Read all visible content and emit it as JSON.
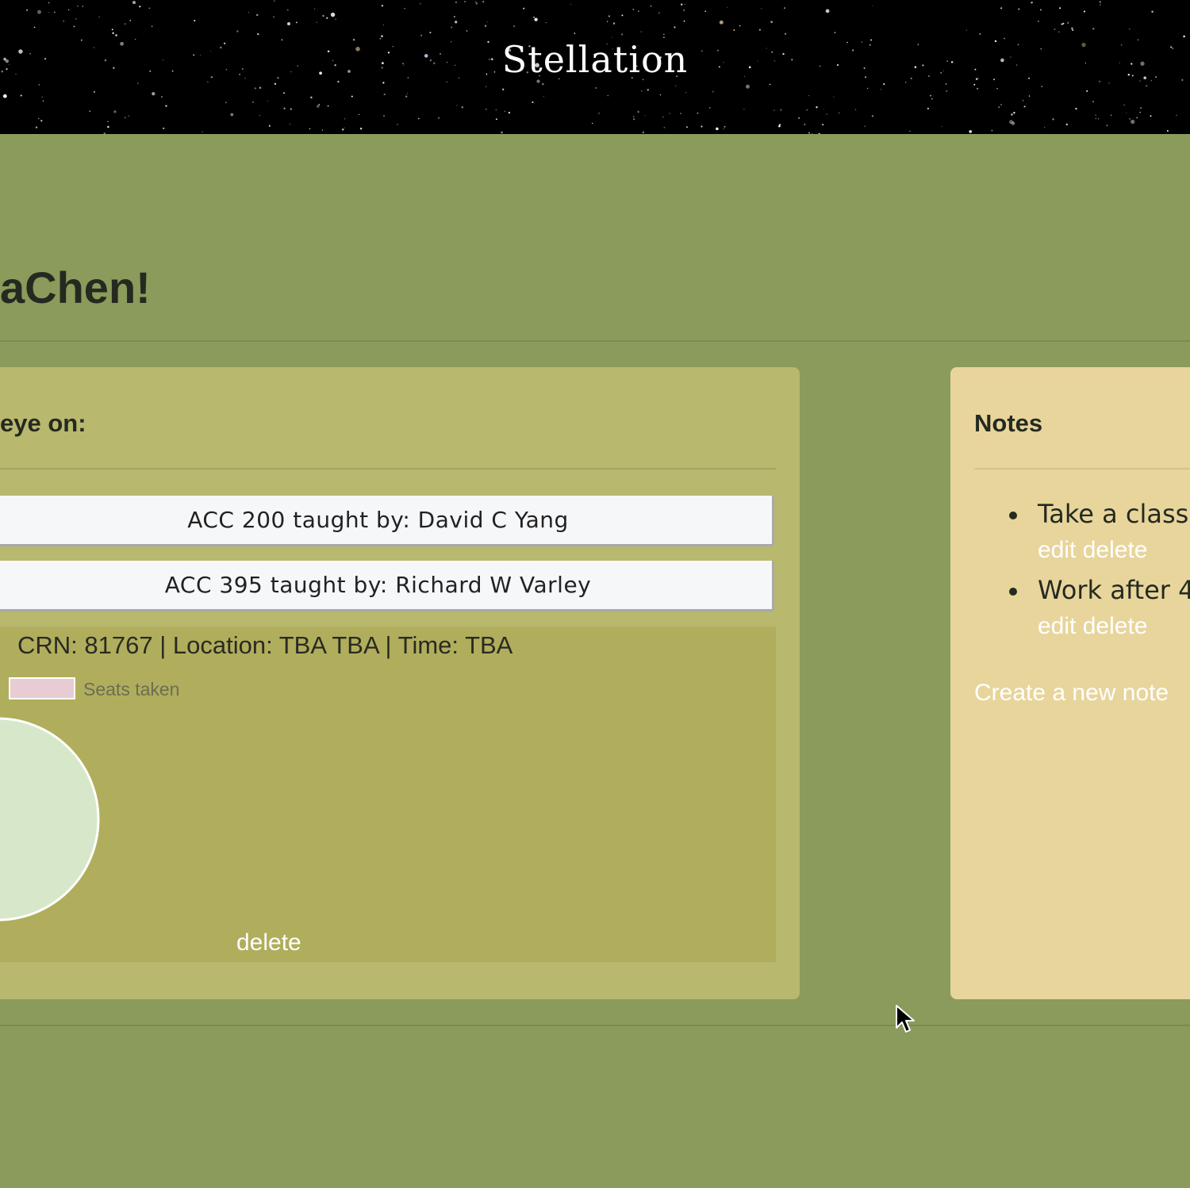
{
  "header": {
    "brand": "Stellation"
  },
  "welcome": {
    "text": "aChen!"
  },
  "watchlist": {
    "title": "eye on:",
    "courses": [
      {
        "label": "ACC 200 taught by: David C Yang"
      },
      {
        "label": "ACC 395 taught by: Richard W Varley"
      }
    ],
    "details": {
      "info": "CRN: 81767 | Location: TBA TBA | Time: TBA",
      "legend_label": "Seats taken",
      "delete_label": "delete"
    }
  },
  "notes": {
    "title": "Notes",
    "items": [
      {
        "text": "Take a class",
        "edit_label": "edit",
        "delete_label": "delete"
      },
      {
        "text": "Work after 4",
        "edit_label": "edit",
        "delete_label": "delete"
      }
    ],
    "create_label": "Create a new note"
  },
  "colors": {
    "page_bg": "#8a9b5c",
    "watch_panel": "#b8b86f",
    "details_bg": "#b0ae5c",
    "notes_panel": "#e8d59c",
    "seats_taken": "#e8ccd3",
    "seats_open": "#d6e8c9"
  }
}
